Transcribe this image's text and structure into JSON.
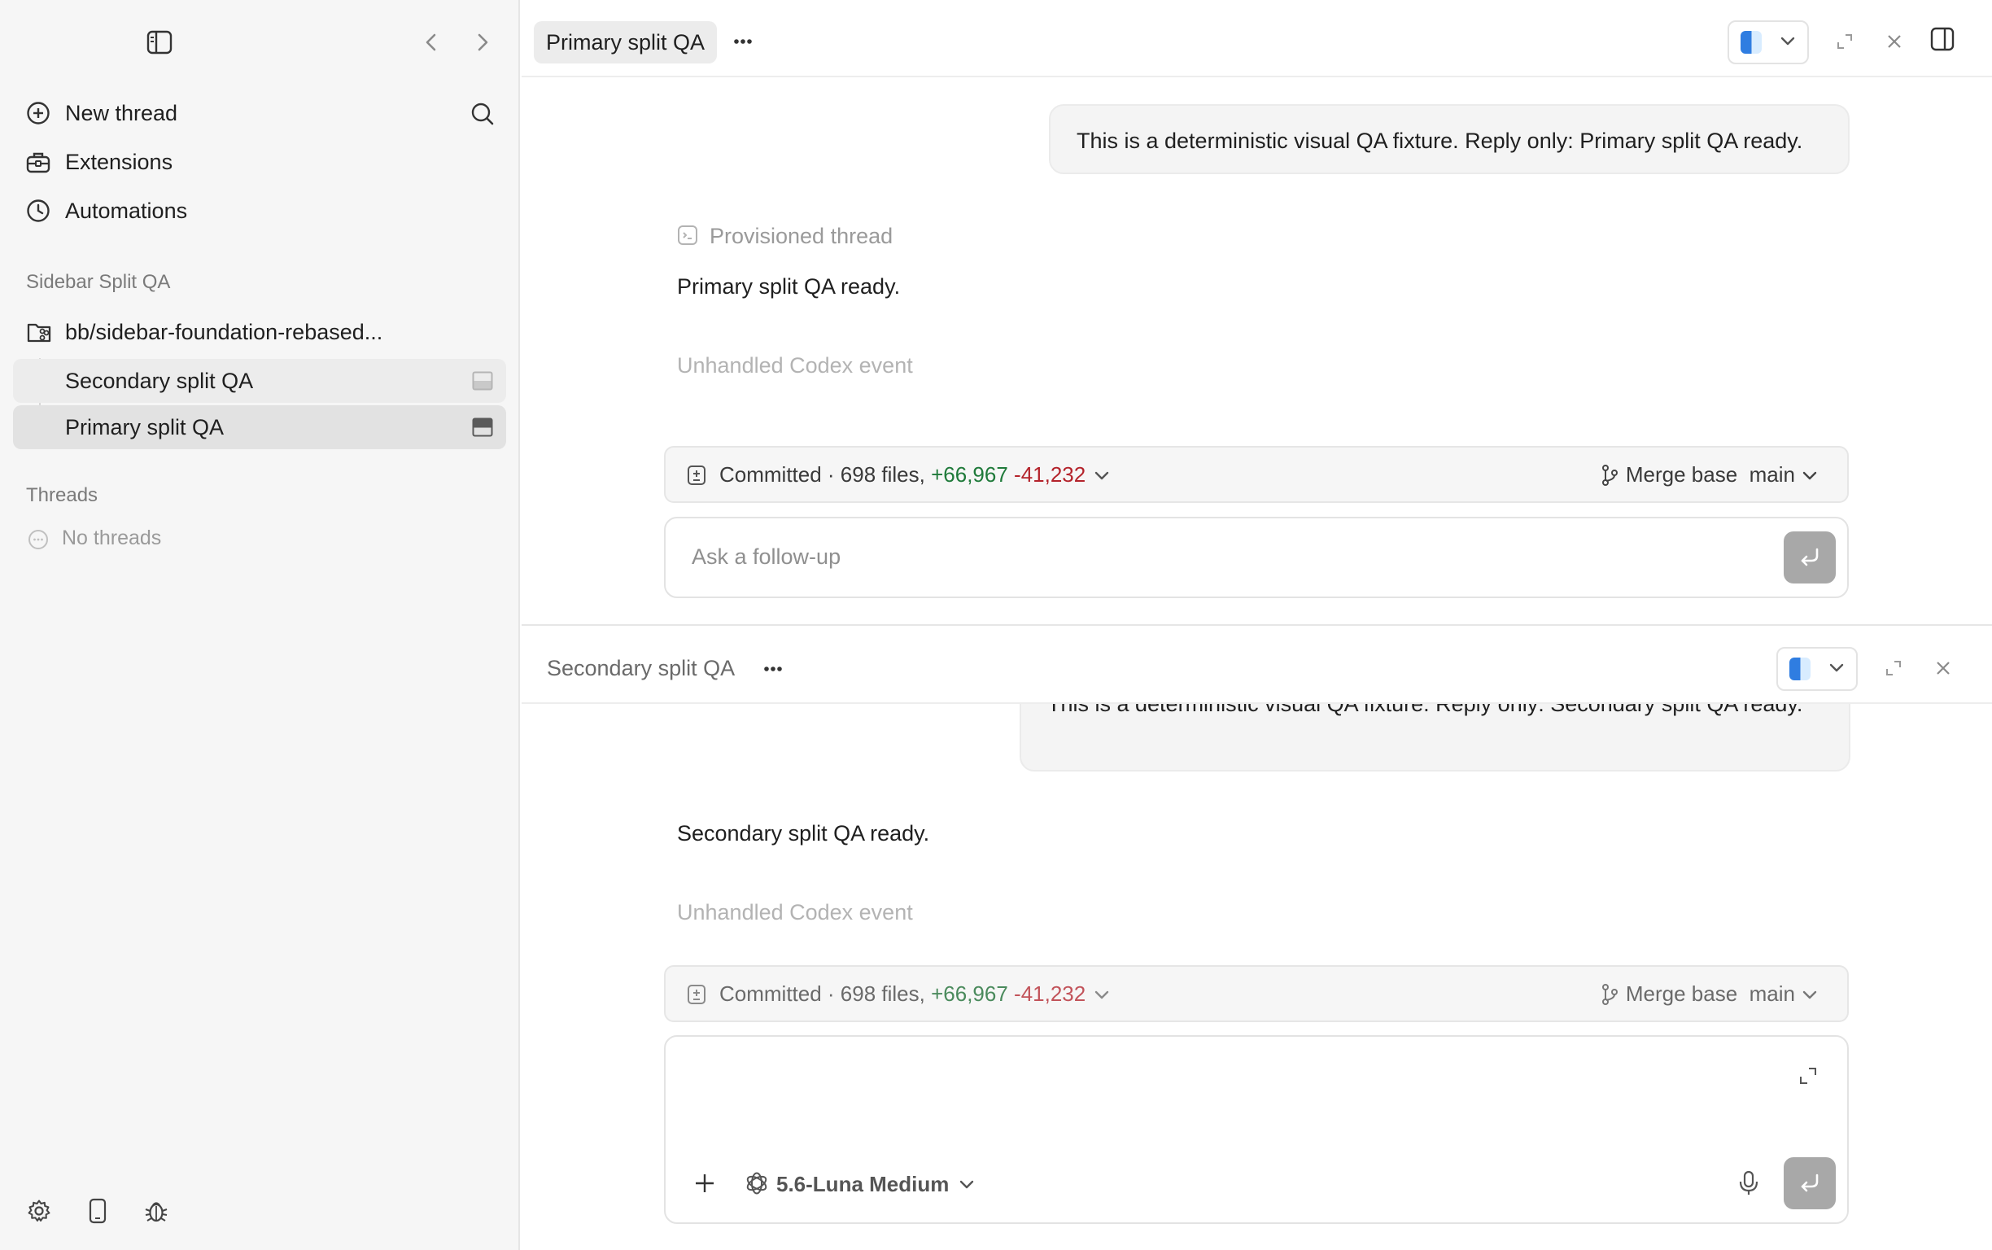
{
  "sidebar": {
    "nav": {
      "new_thread": "New thread",
      "extensions": "Extensions",
      "automations": "Automations"
    },
    "project": {
      "name": "Sidebar Split QA",
      "branch": "bb/sidebar-foundation-rebased..."
    },
    "project_threads": [
      {
        "label": "Secondary split QA"
      },
      {
        "label": "Primary split QA"
      }
    ],
    "threads_section": {
      "label": "Threads",
      "empty": "No threads"
    }
  },
  "primary_pane": {
    "title": "Primary split QA",
    "user_message": "This is a deterministic visual QA fixture. Reply only: Primary split QA ready.",
    "provisioned_label": "Provisioned thread",
    "assistant_reply": "Primary split QA ready.",
    "unhandled_event": "Unhandled Codex event",
    "changes": {
      "prefix": "Committed · 698 files, ",
      "additions": "+66,967",
      "deletions": "-41,232"
    },
    "merge": {
      "label": "Merge base",
      "branch": "main"
    },
    "composer_placeholder": "Ask a follow-up"
  },
  "secondary_pane": {
    "title": "Secondary split QA",
    "user_message": "This is a deterministic visual QA fixture. Reply only: Secondary split QA ready.",
    "assistant_reply": "Secondary split QA ready.",
    "unhandled_event": "Unhandled Codex event",
    "changes": {
      "prefix": "Committed · 698 files, ",
      "additions": "+66,967",
      "deletions": "-41,232"
    },
    "merge": {
      "label": "Merge base",
      "branch": "main"
    },
    "model": "5.6-Luna Medium"
  },
  "icons": {
    "toggle_sidebar": "sidebar-toggle-icon",
    "back": "chevron-left-icon",
    "forward": "chevron-right-icon",
    "new_thread": "plus-circle-icon",
    "search": "search-icon",
    "extensions": "toolbox-icon",
    "automations": "clock-icon",
    "repo": "folder-branch-icon",
    "finder": "finder-icon",
    "settings": "gear-icon",
    "phone": "phone-icon",
    "bug": "bug-icon"
  },
  "colors": {
    "additions": "#1f7a3a",
    "deletions": "#b4232b",
    "send_button": "#a8a8a8",
    "sidebar_bg": "#f6f6f6"
  }
}
